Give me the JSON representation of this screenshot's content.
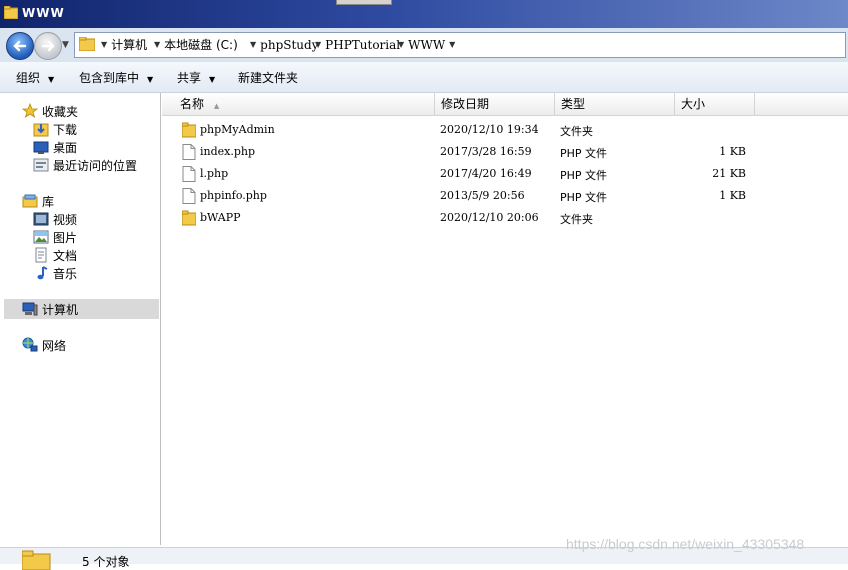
{
  "window": {
    "title": "WWW"
  },
  "address": {
    "crumbs": [
      "计算机",
      "本地磁盘 (C:)",
      "phpStudy",
      "PHPTutorial",
      "WWW"
    ]
  },
  "toolbar": {
    "organize": "组织",
    "include_library": "包含到库中",
    "share": "共享",
    "new_folder": "新建文件夹"
  },
  "nav": {
    "favorites": "收藏夹",
    "downloads": "下载",
    "desktop": "桌面",
    "recent": "最近访问的位置",
    "libraries": "库",
    "videos": "视频",
    "pictures": "图片",
    "documents": "文档",
    "music": "音乐",
    "computer": "计算机",
    "network": "网络"
  },
  "columns": {
    "name": "名称",
    "modified": "修改日期",
    "type": "类型",
    "size": "大小"
  },
  "files": [
    {
      "name": "phpMyAdmin",
      "modified": "2020/12/10 19:34",
      "type": "文件夹",
      "size": "",
      "kind": "folder"
    },
    {
      "name": "index.php",
      "modified": "2017/3/28 16:59",
      "type": "PHP 文件",
      "size": "1 KB",
      "kind": "file"
    },
    {
      "name": "l.php",
      "modified": "2017/4/20 16:49",
      "type": "PHP 文件",
      "size": "21 KB",
      "kind": "file"
    },
    {
      "name": "phpinfo.php",
      "modified": "2013/5/9 20:56",
      "type": "PHP 文件",
      "size": "1 KB",
      "kind": "file"
    },
    {
      "name": "bWAPP",
      "modified": "2020/12/10 20:06",
      "type": "文件夹",
      "size": "",
      "kind": "folder"
    }
  ],
  "status": {
    "count": "5 个对象"
  },
  "watermark": "https://blog.csdn.net/weixin_43305348"
}
